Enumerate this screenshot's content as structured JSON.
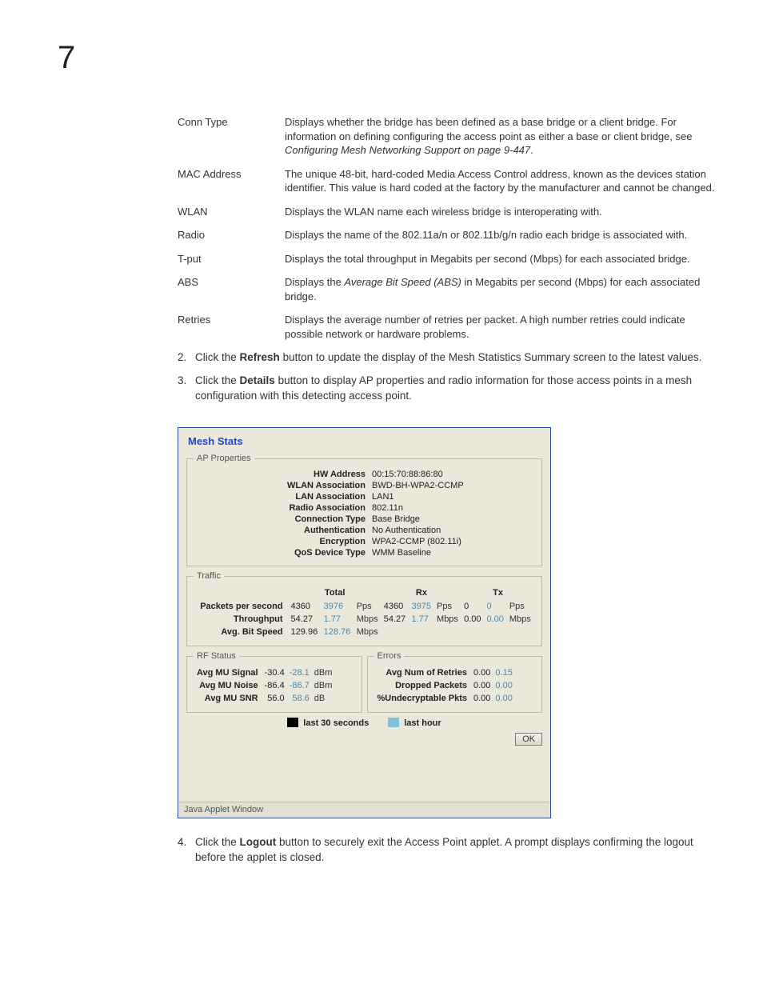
{
  "chapter_number": "7",
  "defs": [
    {
      "term": "Conn Type",
      "desc": "Displays whether the bridge has been defined as a base bridge or a client bridge. For information on defining configuring the access point as either a base or client bridge, see ",
      "ital": "Configuring Mesh Networking Support on page 9-447",
      "tail": "."
    },
    {
      "term": "MAC Address",
      "desc": "The unique 48-bit, hard-coded Media Access Control address, known as the devices station identifier. This value is hard coded at the factory by the manufacturer and cannot be changed."
    },
    {
      "term": "WLAN",
      "desc": "Displays the WLAN name each wireless bridge is interoperating with."
    },
    {
      "term": "Radio",
      "desc": "Displays the name of the 802.11a/n or 802.11b/g/n radio each bridge is associated with."
    },
    {
      "term": "T-put",
      "desc": "Displays the total throughput in Megabits per second (Mbps) for each associated bridge."
    },
    {
      "term": "ABS",
      "pre": "Displays the ",
      "ital": "Average Bit Speed (ABS)",
      "desc": " in Megabits per second (Mbps) for each associated bridge."
    },
    {
      "term": "Retries",
      "desc": "Displays the average number of retries per packet. A high number retries could indicate possible network or hardware problems."
    }
  ],
  "step2_num": "2.",
  "step2_pre": "Click the ",
  "step2_bold": "Refresh",
  "step2_post": " button to update the display of the Mesh Statistics Summary screen to the latest values.",
  "step3_num": "3.",
  "step3_pre": "Click the ",
  "step3_bold": "Details",
  "step3_post": " button to display AP properties and radio information for those access points in a mesh configuration with this detecting access point.",
  "step4_num": "4.",
  "step4_pre": "Click the ",
  "step4_bold": "Logout",
  "step4_post": " button to securely exit the Access Point applet. A prompt displays confirming the logout before the applet is closed.",
  "dialog": {
    "title": "Mesh Stats",
    "ap_legend": "AP Properties",
    "props": {
      "hw_label": "HW Address",
      "hw_val": "00:15:70:88:86:80",
      "wlan_label": "WLAN Association",
      "wlan_val": "BWD-BH-WPA2-CCMP",
      "lan_label": "LAN Association",
      "lan_val": "LAN1",
      "radio_label": "Radio Association",
      "radio_val": "802.11n",
      "conn_label": "Connection Type",
      "conn_val": "Base Bridge",
      "auth_label": "Authentication",
      "auth_val": "No Authentication",
      "enc_label": "Encryption",
      "enc_val": "WPA2-CCMP (802.11i)",
      "qos_label": "QoS Device Type",
      "qos_val": "WMM Baseline"
    },
    "traffic_legend": "Traffic",
    "traffic": {
      "col_total": "Total",
      "col_rx": "Rx",
      "col_tx": "Tx",
      "row_pps": "Packets per second",
      "pps_t30": "4360",
      "pps_thr": "3976",
      "pps_tun": "Pps",
      "pps_r30": "4360",
      "pps_rhr": "3975",
      "pps_run": "Pps",
      "pps_x30": "0",
      "pps_xhr": "0",
      "pps_xun": "Pps",
      "row_thr": "Throughput",
      "thr_t30": "54.27",
      "thr_thr": "1.77",
      "thr_tun": "Mbps",
      "thr_r30": "54.27",
      "thr_rhr": "1.77",
      "thr_run": "Mbps",
      "thr_x30": "0.00",
      "thr_xhr": "0.00",
      "thr_xun": "Mbps",
      "row_abs": "Avg. Bit Speed",
      "abs_t30": "129.96",
      "abs_thr": "128.76",
      "abs_tun": "Mbps"
    },
    "rf_legend": "RF Status",
    "rf": {
      "sig_label": "Avg MU Signal",
      "sig_30": "-30.4",
      "sig_hr": "-28.1",
      "sig_un": "dBm",
      "noi_label": "Avg MU Noise",
      "noi_30": "-86.4",
      "noi_hr": "-86.7",
      "noi_un": "dBm",
      "snr_label": "Avg MU SNR",
      "snr_30": "56.0",
      "snr_hr": "58.6",
      "snr_un": "dB"
    },
    "err_legend": "Errors",
    "err": {
      "ret_label": "Avg Num of Retries",
      "ret_30": "0.00",
      "ret_hr": "0.15",
      "drp_label": "Dropped Packets",
      "drp_30": "0.00",
      "drp_hr": "0.00",
      "und_label": "%Undecryptable Pkts",
      "und_30": "0.00",
      "und_hr": "0.00"
    },
    "legend_30": "last 30 seconds",
    "legend_hr": "last hour",
    "ok_label": "OK",
    "status_bar": "Java Applet Window"
  }
}
